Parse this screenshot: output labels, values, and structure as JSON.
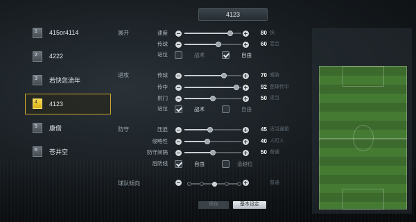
{
  "header": {
    "formation_tab": "4123"
  },
  "tactics_list": [
    {
      "num": "1",
      "label": "415or4114",
      "active": false
    },
    {
      "num": "2",
      "label": "4222",
      "active": false
    },
    {
      "num": "3",
      "label": "若快您流年",
      "active": false
    },
    {
      "num": "4",
      "label": "4123",
      "active": true
    },
    {
      "num": "5",
      "label": "康僧",
      "active": false
    },
    {
      "num": "6",
      "label": "苍井空",
      "active": false
    }
  ],
  "sections": {
    "buildup": "展开",
    "chance": "进攻",
    "defence": "防守",
    "team_shape": "球队倾向"
  },
  "buildup": {
    "speed": {
      "label": "速度",
      "value": "80",
      "desc": "快",
      "pct": 0.8
    },
    "passing": {
      "label": "传球",
      "value": "60",
      "desc": "混合",
      "pct": 0.6
    },
    "positioning": {
      "label": "站位",
      "opt1": "战术",
      "opt2": "自由",
      "selected": "opt2"
    }
  },
  "chance": {
    "passing": {
      "label": "传球",
      "value": "70",
      "desc": "威胁",
      "pct": 0.7
    },
    "crossing": {
      "label": "传中",
      "value": "92",
      "desc": "医球传中",
      "pct": 0.92
    },
    "shooting": {
      "label": "射门",
      "value": "50",
      "desc": "适当",
      "pct": 0.5
    },
    "positioning": {
      "label": "站位",
      "opt1": "战术",
      "opt2": "自由",
      "selected": "opt1"
    }
  },
  "defence": {
    "pressure": {
      "label": "压迫",
      "value": "45",
      "desc": "适当逼抢",
      "pct": 0.45
    },
    "aggression": {
      "label": "侵略性",
      "value": "40",
      "desc": "人盯人",
      "pct": 0.4
    },
    "width": {
      "label": "防守间隔",
      "value": "50",
      "desc": "普通",
      "pct": 0.5
    },
    "line": {
      "label": "后防线",
      "opt1": "自由",
      "opt2": "造越位",
      "selected": "opt1"
    }
  },
  "team_shape": {
    "value_desc": "普通",
    "steps": 5,
    "selected_index": 2
  },
  "bottom": {
    "left_button": "保存",
    "right_button": "基本设定"
  }
}
